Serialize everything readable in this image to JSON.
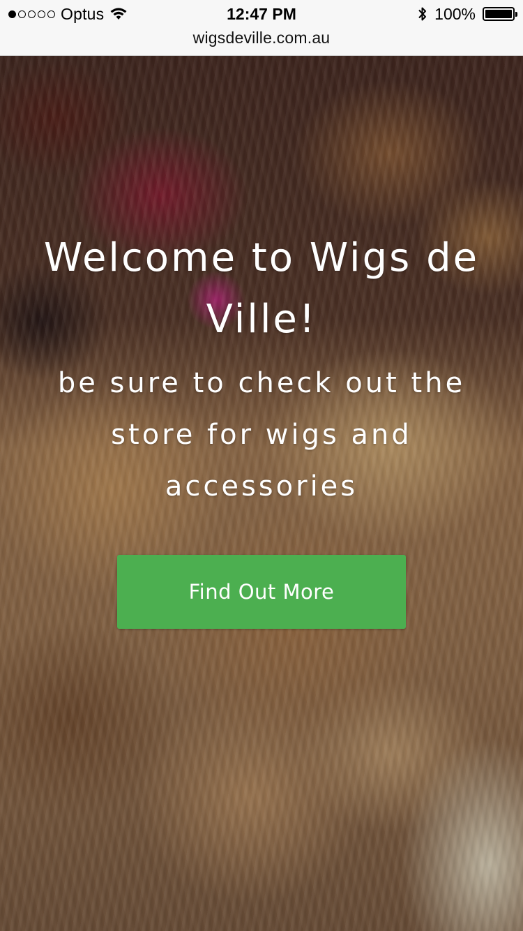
{
  "status_bar": {
    "carrier": "Optus",
    "signal_bars_filled": 1,
    "signal_bars_total": 5,
    "time": "12:47 PM",
    "battery_percent": "100%",
    "icons": [
      "wifi-icon",
      "bluetooth-icon",
      "battery-icon"
    ]
  },
  "url_bar": {
    "url": "wigsdeville.com.au"
  },
  "hero": {
    "title": "Welcome to Wigs de Ville!",
    "subtitle": "be sure to check out the store for wigs and accessories",
    "cta_label": "Find Out More"
  },
  "colors": {
    "cta_background": "#4caf50",
    "chrome_background": "#f7f7f7",
    "hero_text": "#ffffff"
  }
}
